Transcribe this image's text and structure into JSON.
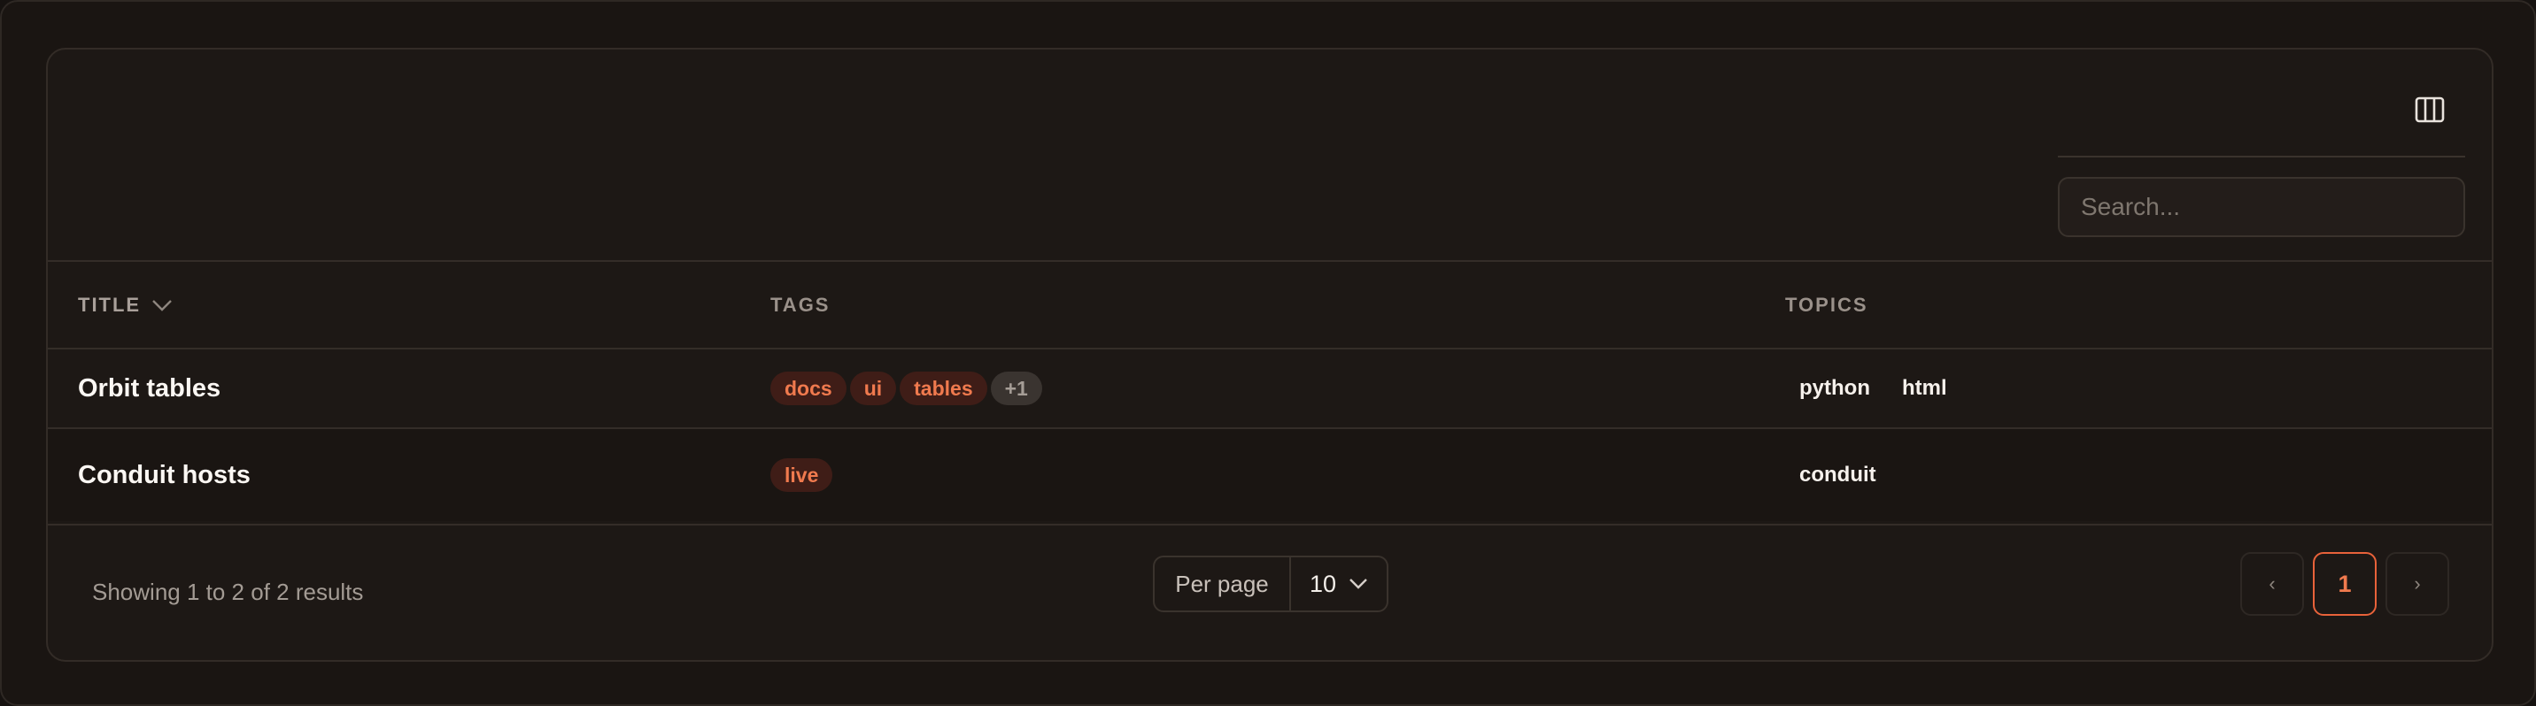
{
  "toolbar": {
    "search_placeholder": "Search..."
  },
  "table": {
    "columns": {
      "title": "TITLE",
      "tags": "TAGS",
      "topics": "TOPICS"
    },
    "sort_direction": "descending",
    "rows": [
      {
        "title": "Orbit tables",
        "tags": [
          "docs",
          "ui",
          "tables"
        ],
        "tags_more": "+1",
        "topics": [
          "python",
          "html"
        ]
      },
      {
        "title": "Conduit hosts",
        "tags": [
          "live"
        ],
        "topics": [
          "conduit"
        ]
      }
    ]
  },
  "footer": {
    "showing": "Showing 1 to 2 of 2 results",
    "per_page_label": "Per page",
    "per_page_value": "10",
    "prev_label": "‹",
    "next_label": "›",
    "current_page": "1"
  },
  "colors": {
    "accent": "#f07a4e",
    "tag_bg": "#3f1d17",
    "background": "#1d1815"
  },
  "icons": {
    "columns_toggle": "columns-icon",
    "sort": "chevron-down-icon",
    "per_page_dropdown": "chevron-down-icon"
  }
}
